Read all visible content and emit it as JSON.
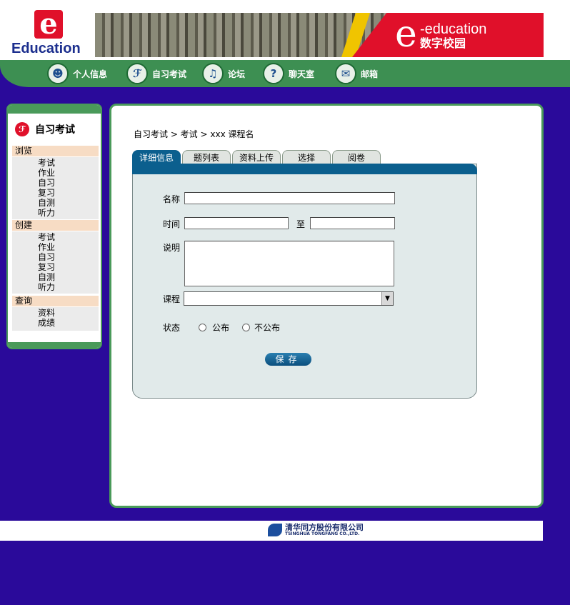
{
  "header": {
    "logo_letter": "e",
    "logo_text": "Education",
    "banner_e": "e",
    "banner_line1": "-education",
    "banner_line2": "数字校园"
  },
  "nav": {
    "items": [
      {
        "label": "个人信息",
        "icon": "person-icon"
      },
      {
        "label": "自习考试",
        "icon": "exam-icon"
      },
      {
        "label": "论坛",
        "icon": "microphone-icon"
      },
      {
        "label": "聊天室",
        "icon": "chat-icon"
      },
      {
        "label": "邮箱",
        "icon": "mail-icon"
      }
    ]
  },
  "sidebar": {
    "title": "自习考试",
    "sections": [
      {
        "header": "浏览",
        "items": [
          "考试",
          "作业",
          "自习",
          "复习",
          "自测",
          "听力"
        ]
      },
      {
        "header": "创建",
        "items": [
          "考试",
          "作业",
          "自习",
          "复习",
          "自测",
          "听力"
        ]
      },
      {
        "header": "查询",
        "items": [
          "资料",
          "成绩"
        ]
      }
    ]
  },
  "breadcrumb": "自习考试 > 考试 > xxx 课程名",
  "tabs": [
    {
      "label": "详细信息",
      "active": true
    },
    {
      "label": "题列表",
      "active": false
    },
    {
      "label": "资料上传",
      "active": false
    },
    {
      "label": "选择",
      "active": false
    },
    {
      "label": "阅卷",
      "active": false
    }
  ],
  "form": {
    "name_label": "名称",
    "name_value": "",
    "time_label": "时间",
    "time_to": "至",
    "time_start": "",
    "time_end": "",
    "desc_label": "说明",
    "desc_value": "",
    "course_label": "课程",
    "course_value": "",
    "status_label": "状态",
    "status_public": "公布",
    "status_private": "不公布",
    "save_label": "保存"
  },
  "footer": {
    "company_cn": "清华同方股份有限公司",
    "company_en": "TSINGHUA TONGFANG CO.,LTD."
  },
  "colors": {
    "background": "#2a0a9a",
    "nav_green": "#3d8f52",
    "tab_active": "#0b5f8e",
    "brand_red": "#e0102a"
  }
}
